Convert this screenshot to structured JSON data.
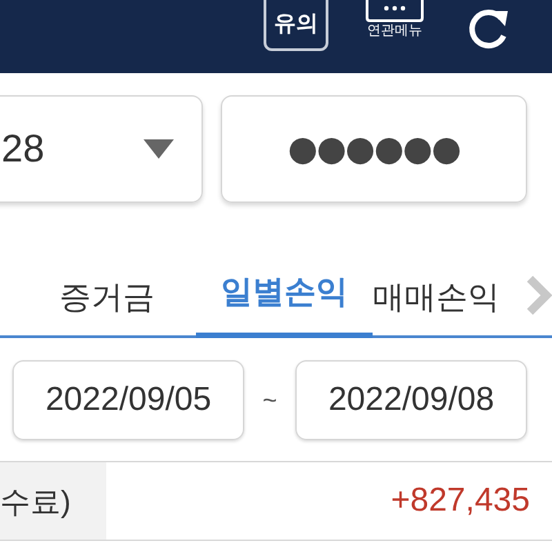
{
  "header": {
    "notice_button": "유의",
    "related_menu": "연관메뉴"
  },
  "account": {
    "value": "28"
  },
  "password": {
    "value": "●●●●●●"
  },
  "tabs": [
    {
      "label": "증거금",
      "selected": false
    },
    {
      "label": "일별손익",
      "selected": true
    },
    {
      "label": "매매손익",
      "selected": false
    }
  ],
  "date_range": {
    "start": "2022/09/05",
    "separator": "~",
    "end": "2022/09/08"
  },
  "summary": {
    "label": "수료)",
    "value": "+827,435"
  }
}
